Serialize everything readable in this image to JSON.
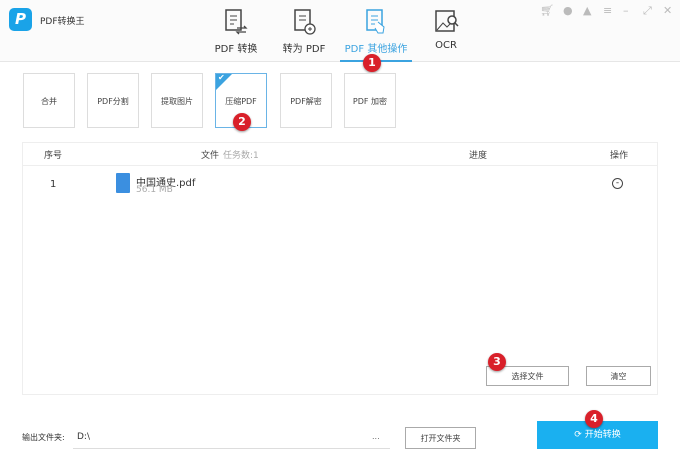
{
  "app": {
    "title": "PDF转换王",
    "logo_letter": "P"
  },
  "tabs": [
    {
      "label": "PDF 转换"
    },
    {
      "label": "转为 PDF"
    },
    {
      "label": "PDF 其他操作"
    },
    {
      "label": "OCR"
    }
  ],
  "window_controls": [
    "cart-icon",
    "user-icon",
    "bell-icon",
    "menu-icon",
    "minimize-icon",
    "maximize-icon",
    "close-icon"
  ],
  "tools": [
    {
      "label": "合并"
    },
    {
      "label": "PDF分割"
    },
    {
      "label": "提取图片"
    },
    {
      "label": "压缩PDF",
      "selected": true
    },
    {
      "label": "PDF解密"
    },
    {
      "label": "PDF 加密"
    }
  ],
  "table": {
    "headers": {
      "index": "序号",
      "file": "文件",
      "task_count": "任务数:1",
      "progress": "进度",
      "action": "操作"
    },
    "rows": [
      {
        "index": "1",
        "name": "中国通史.pdf",
        "size": "56.1 MB"
      }
    ]
  },
  "buttons": {
    "select_file": "选择文件",
    "clear": "清空",
    "open_folder": "打开文件夹",
    "start": "开始转换",
    "browse": "..."
  },
  "output": {
    "label": "输出文件夹:",
    "value": "D:\\"
  },
  "badges": [
    "1",
    "2",
    "3",
    "4"
  ],
  "colors": {
    "accent": "#3ba3e0",
    "start_button": "#1ab0f0",
    "badge": "#d9202a"
  }
}
